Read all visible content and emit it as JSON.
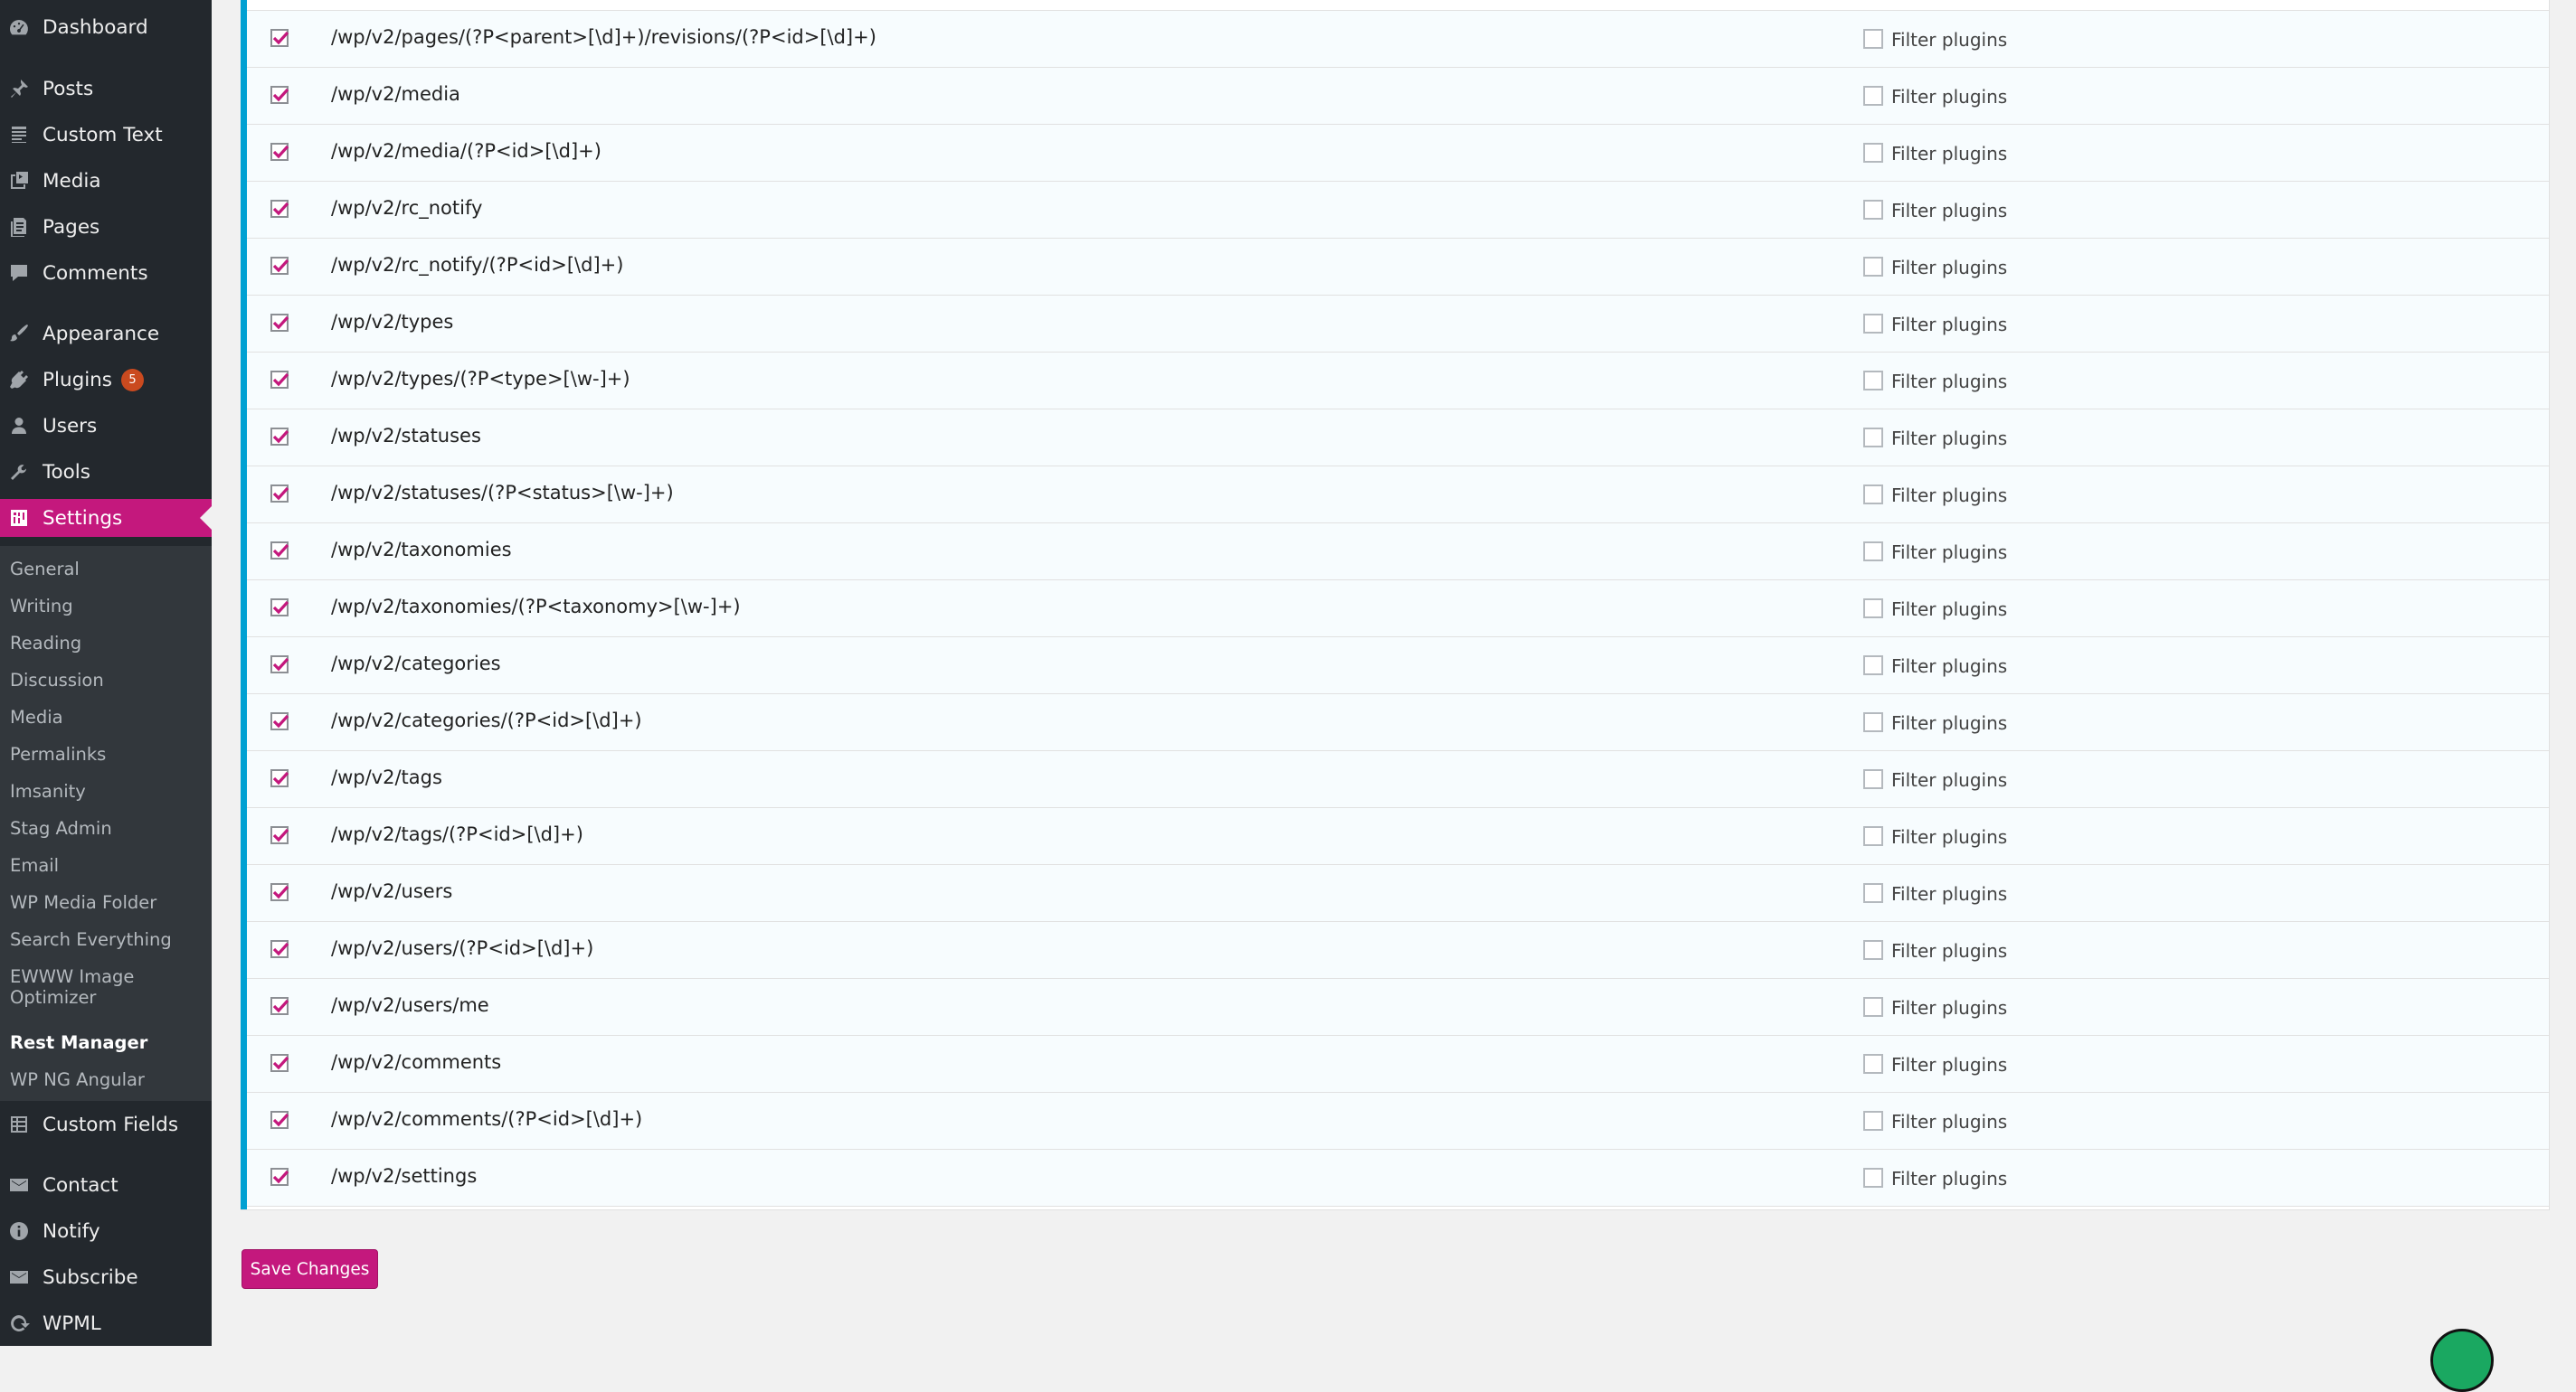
{
  "sidebar": {
    "menu": [
      {
        "label": "Dashboard",
        "icon": "dashboard-icon"
      },
      {
        "label": "Posts",
        "icon": "pin-icon"
      },
      {
        "label": "Custom Text",
        "icon": "document-icon"
      },
      {
        "label": "Media",
        "icon": "media-icon"
      },
      {
        "label": "Pages",
        "icon": "pages-icon"
      },
      {
        "label": "Comments",
        "icon": "speech-bubble-icon"
      },
      {
        "label": "Appearance",
        "icon": "paintbrush-icon"
      },
      {
        "label": "Plugins",
        "icon": "plug-icon",
        "badge": "5"
      },
      {
        "label": "Users",
        "icon": "user-icon"
      },
      {
        "label": "Tools",
        "icon": "wrench-icon"
      },
      {
        "label": "Settings",
        "icon": "settings-icon",
        "active": true
      }
    ],
    "submenu": [
      "General",
      "Writing",
      "Reading",
      "Discussion",
      "Media",
      "Permalinks",
      "Imsanity",
      "Stag Admin",
      "Email",
      "WP Media Folder",
      "Search Everything",
      "EWWW Image Optimizer",
      "Rest Manager",
      "WP NG Angular"
    ],
    "submenu_current": "Rest Manager",
    "menu_bottom": [
      {
        "label": "Custom Fields",
        "icon": "table-icon"
      },
      {
        "label": "Contact",
        "icon": "mail-icon"
      },
      {
        "label": "Notify",
        "icon": "info-icon"
      },
      {
        "label": "Subscribe",
        "icon": "mail-icon"
      },
      {
        "label": "WPML",
        "icon": "wpml-icon"
      }
    ]
  },
  "routes": [
    "/wp/v2/pages/(?P<parent>[\\d]+)/revisions/(?P<id>[\\d]+)",
    "/wp/v2/media",
    "/wp/v2/media/(?P<id>[\\d]+)",
    "/wp/v2/rc_notify",
    "/wp/v2/rc_notify/(?P<id>[\\d]+)",
    "/wp/v2/types",
    "/wp/v2/types/(?P<type>[\\w-]+)",
    "/wp/v2/statuses",
    "/wp/v2/statuses/(?P<status>[\\w-]+)",
    "/wp/v2/taxonomies",
    "/wp/v2/taxonomies/(?P<taxonomy>[\\w-]+)",
    "/wp/v2/categories",
    "/wp/v2/categories/(?P<id>[\\d]+)",
    "/wp/v2/tags",
    "/wp/v2/tags/(?P<id>[\\d]+)",
    "/wp/v2/users",
    "/wp/v2/users/(?P<id>[\\d]+)",
    "/wp/v2/users/me",
    "/wp/v2/comments",
    "/wp/v2/comments/(?P<id>[\\d]+)",
    "/wp/v2/settings"
  ],
  "route_enabled": true,
  "filter_label": "Filter plugins",
  "filter_checked": false,
  "save_label": "Save Changes",
  "colors": {
    "sidebar_bg": "#23282d",
    "submenu_bg": "#32373c",
    "accent": "#c4187d",
    "row_bg": "#f7fcfe",
    "page_bg": "#f1f1f1",
    "badge": "#ca4a1f",
    "accent_bar": "#00a0d2"
  }
}
